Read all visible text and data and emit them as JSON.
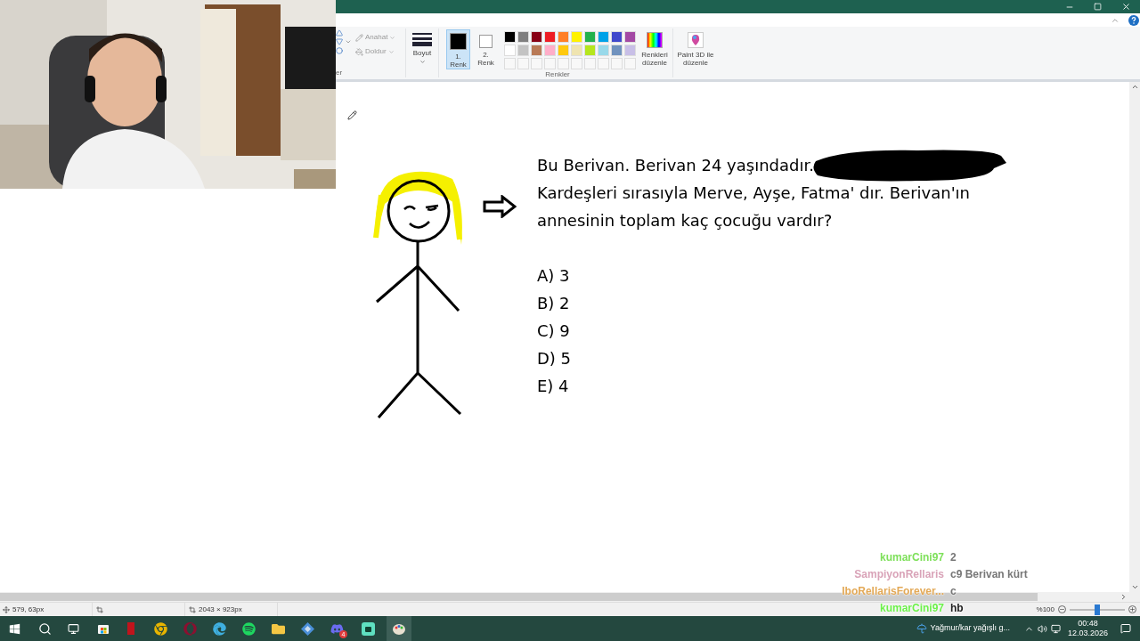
{
  "ribbon": {
    "partial_group_label": "er",
    "outline_label": "Anahat",
    "fill_label": "Doldur",
    "size_label": "Boyut",
    "color_slots": [
      {
        "label": "1. Renk",
        "color": "#000000",
        "selected": true
      },
      {
        "label": "2. Renk",
        "color": "#ffffff",
        "selected": false
      }
    ],
    "palette": [
      {
        "color": "#000000"
      },
      {
        "color": "#7f7f7f"
      },
      {
        "color": "#880015"
      },
      {
        "color": "#ed1c24"
      },
      {
        "color": "#ff7f27"
      },
      {
        "color": "#fff200"
      },
      {
        "color": "#22b14c"
      },
      {
        "color": "#00a2e8"
      },
      {
        "color": "#3f48cc"
      },
      {
        "color": "#a349a4"
      },
      {
        "color": "#ffffff"
      },
      {
        "color": "#c3c3c3"
      },
      {
        "color": "#b97a57"
      },
      {
        "color": "#ffaec9"
      },
      {
        "color": "#ffc90e"
      },
      {
        "color": "#efe4b0"
      },
      {
        "color": "#b5e61d"
      },
      {
        "color": "#99d9ea"
      },
      {
        "color": "#7092be"
      },
      {
        "color": "#c8bfe7"
      }
    ],
    "edit_colors_label": "Renkleri düzenle",
    "paint3d_label": "Paint 3D ile düzenle",
    "group_label": "Renkler"
  },
  "canvas": {
    "question_lines": [
      "Bu Berivan. Berivan 24 yaşındadır.",
      "Kardeşleri sırasıyla Merve, Ayşe, Fatma' dır. Berivan'ın",
      "annesinin toplam kaç çocuğu vardır?"
    ],
    "options": [
      "A) 3",
      "B) 2",
      "C) 9",
      "D) 5",
      "E) 4"
    ]
  },
  "chat": [
    {
      "user": "kumarCini97",
      "message": "2",
      "color": "#7ee05a"
    },
    {
      "user": "SampiyonRellaris",
      "message": "c9 Berivan kürt",
      "color": "#d9a3b8"
    },
    {
      "user": "IboRellarisForever...",
      "message": "c",
      "color": "#e3a957"
    },
    {
      "user": "kumarCini97",
      "message": "hb",
      "color": "#6cf04a"
    }
  ],
  "status_bar": {
    "cursor": "579, 63px",
    "canvas_size": "2043 × 923px",
    "zoom": "%100",
    "zoom_slider": {
      "level": 0.5
    }
  },
  "taskbar": {
    "badge": "4",
    "weather": "Yağmur/kar yağışlı g...",
    "time": "00:48",
    "date": "12.03.2026"
  }
}
